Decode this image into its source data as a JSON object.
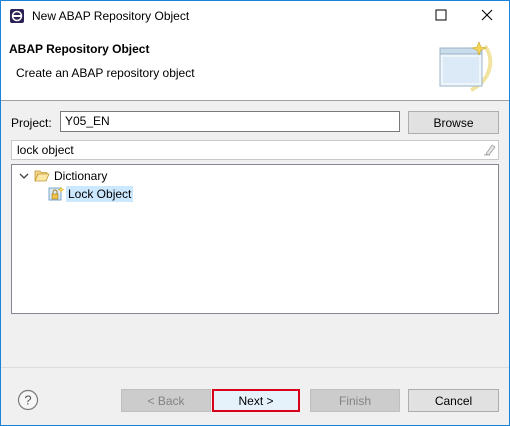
{
  "window": {
    "title": "New ABAP Repository Object",
    "border_color": "#1883d7"
  },
  "titlebar_icons": {
    "app": "eclipse-app-icon",
    "maximize": "maximize-icon",
    "close": "close-icon"
  },
  "banner": {
    "title": "ABAP Repository Object",
    "subtitle": "Create an ABAP repository object",
    "graphic": "new-object-wizard-graphic"
  },
  "project": {
    "label": "Project:",
    "value": "Y05_EN",
    "browse_label": "Browse"
  },
  "filter": {
    "value": "lock object",
    "clear_icon": "eraser-icon"
  },
  "tree": {
    "items": [
      {
        "label": "Dictionary",
        "expanded": true,
        "icon": "folder-open-icon"
      },
      {
        "label": "Lock Object",
        "selected": true,
        "icon": "lock-object-icon"
      }
    ],
    "selection_color": "#cce8ff"
  },
  "footer": {
    "help_icon": "help-icon",
    "back_label": "< Back",
    "next_label": "Next >",
    "finish_label": "Finish",
    "cancel_label": "Cancel",
    "highlight_color": "#d9001b"
  }
}
